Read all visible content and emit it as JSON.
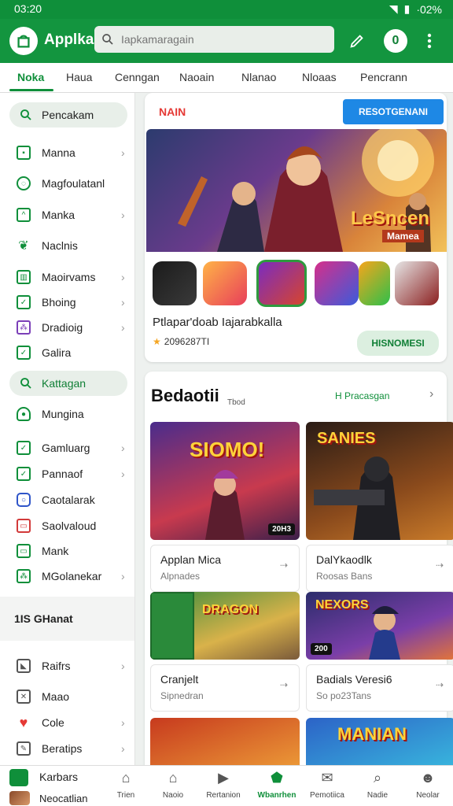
{
  "status_bar": {
    "time": "03:20",
    "battery": "·02%"
  },
  "app_bar": {
    "app_name": "Applka",
    "search_placeholder": "Iapkamaragain",
    "avatar_letter": "0"
  },
  "tabs": [
    {
      "label": "Noka",
      "active": true
    },
    {
      "label": "Haua"
    },
    {
      "label": "Cenngan"
    },
    {
      "label": "Naoain"
    },
    {
      "label": "Nlanao"
    },
    {
      "label": "Nloaas"
    },
    {
      "label": "Pencrann"
    }
  ],
  "sidebar": {
    "items": [
      {
        "label": "Pencakam",
        "icon": "search-icon",
        "highlight": true,
        "chevron": false
      },
      {
        "label": "Manna",
        "icon": "apps-icon",
        "chevron": true
      },
      {
        "label": "Magfoulatanl",
        "icon": "refresh-icon",
        "chevron": false
      },
      {
        "label": "Manka",
        "icon": "chart-icon",
        "chevron": true
      },
      {
        "label": "Naclnis",
        "icon": "leaf-icon",
        "chevron": false
      },
      {
        "label": "Maoirvams",
        "icon": "grid-icon",
        "chevron": true
      },
      {
        "label": "Bhoing",
        "icon": "check-icon",
        "chevron": true
      },
      {
        "label": "Dradioig",
        "icon": "puzzle-icon",
        "chevron": true
      },
      {
        "label": "Galira",
        "icon": "check-icon",
        "chevron": false
      },
      {
        "label": "Kattagan",
        "icon": "search-icon",
        "highlight": true,
        "chevron": false
      },
      {
        "label": "Mungina",
        "icon": "shield-icon",
        "chevron": false
      },
      {
        "label": "Gamluarg",
        "icon": "check-icon",
        "chevron": true
      },
      {
        "label": "Pannaof",
        "icon": "check-icon",
        "chevron": true
      },
      {
        "label": "Caotalarak",
        "icon": "circle-icon",
        "chevron": false
      },
      {
        "label": "Saolvaloud",
        "icon": "tv-icon",
        "chevron": false
      },
      {
        "label": "Mank",
        "icon": "tv-icon",
        "chevron": false
      },
      {
        "label": "MGolanekar",
        "icon": "puzzle-icon",
        "chevron": true
      }
    ],
    "section_title": "1IS GHanat",
    "bottom_items": [
      {
        "label": "Raifrs",
        "icon": "image-icon",
        "chevron": true
      },
      {
        "label": "Maao",
        "icon": "close-icon",
        "chevron": false
      },
      {
        "label": "Cole",
        "icon": "heart-icon",
        "chevron": true
      },
      {
        "label": "Beratips",
        "icon": "edit-icon",
        "chevron": true
      },
      {
        "label": "Karbars",
        "icon": "check-icon",
        "chevron": false
      }
    ],
    "profile_label": "Neocatlian"
  },
  "featured": {
    "section_label": "NAIN",
    "action_button": "RESOTGENANI",
    "banner_text": "LeSncen",
    "banner_subtext": "Mamea",
    "title": "Ptlapar'doab Iajarabkalla",
    "rating": "2096287TI",
    "install_button": "HISNOMESI"
  },
  "games_section": {
    "title": "Bedaotii",
    "subtitle": "Tbod",
    "link": "H Pracasgan",
    "games": [
      {
        "name": "Applan Mica",
        "sub": "Alpnades",
        "badge": "20H3",
        "art_title": "SIOMO!"
      },
      {
        "name": "DalYkaodlk",
        "sub": "Roosas Bans",
        "badge": "",
        "art_title": "SANIES"
      },
      {
        "name": "Cranjelt",
        "sub": "Sipnedran",
        "badge": "",
        "art_title": "DRAGON"
      },
      {
        "name": "Badials Veresi6",
        "sub": "So po23Tans",
        "badge": "200",
        "art_title": "NEXORS"
      }
    ],
    "partial_art": "MANIAN"
  },
  "bottom_nav": [
    {
      "label": "Trien",
      "icon": "home-icon"
    },
    {
      "label": "Naoio",
      "icon": "house-icon"
    },
    {
      "label": "Rertanion",
      "icon": "play-icon"
    },
    {
      "label": "Wbanrhen",
      "icon": "shield-icon",
      "active": true
    },
    {
      "label": "Pemotiica",
      "icon": "mail-icon"
    },
    {
      "label": "Nadie",
      "icon": "search-icon"
    },
    {
      "label": "Neolar",
      "icon": "person-icon"
    }
  ]
}
